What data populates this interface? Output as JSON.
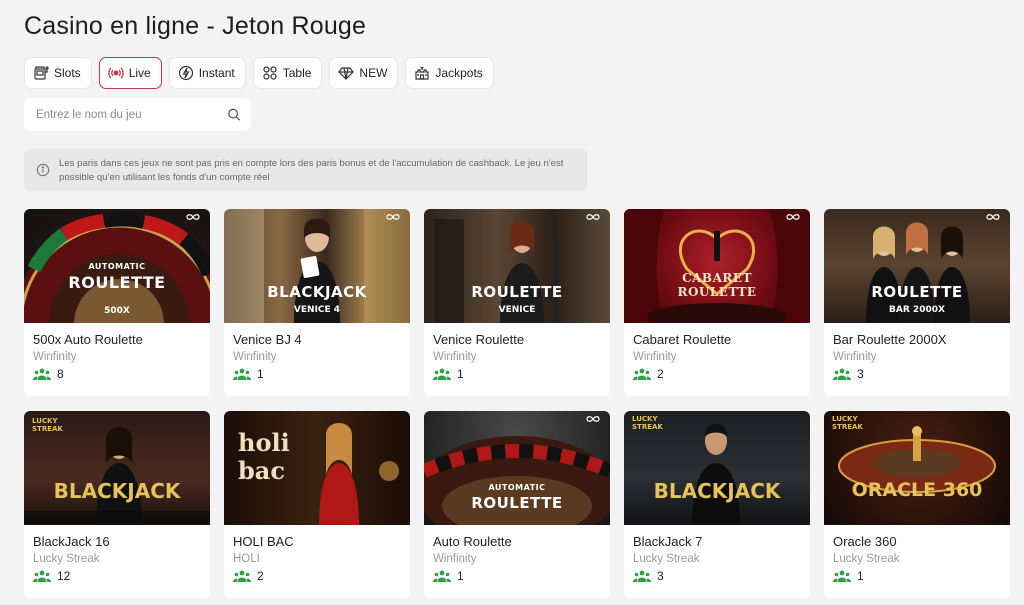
{
  "page": {
    "title": "Casino en ligne - Jeton Rouge"
  },
  "filters": [
    {
      "label": "Slots",
      "icon": "slot-machine-icon",
      "active": false
    },
    {
      "label": "Live",
      "icon": "live-broadcast-icon",
      "active": true
    },
    {
      "label": "Instant",
      "icon": "lightning-icon",
      "active": false
    },
    {
      "label": "Table",
      "icon": "table-games-icon",
      "active": false
    },
    {
      "label": "NEW",
      "icon": "diamond-icon",
      "active": false
    },
    {
      "label": "Jackpots",
      "icon": "castle-icon",
      "active": false
    }
  ],
  "search": {
    "placeholder": "Entrez le nom du jeu"
  },
  "notice": {
    "text": "Les paris dans ces jeux ne sont pas pris en compte lors des paris bonus et de l'accumulation de cashback. Le jeu n'est possible qu'en utilisant les fonds d'un compte réel"
  },
  "colors": {
    "accent": "#c8364a",
    "players_icon": "#2ea043"
  },
  "games": [
    {
      "name": "500x Auto Roulette",
      "provider": "Winfinity",
      "players": "8",
      "thumb": {
        "line1": "AUTOMATIC",
        "line2": "ROULETTE",
        "line3": "500X"
      }
    },
    {
      "name": "Venice BJ 4",
      "provider": "Winfinity",
      "players": "1",
      "thumb": {
        "line1": "",
        "line2": "BLACKJACK",
        "line3": "VENICE 4"
      }
    },
    {
      "name": "Venice Roulette",
      "provider": "Winfinity",
      "players": "1",
      "thumb": {
        "line1": "",
        "line2": "ROULETTE",
        "line3": "VENICE"
      }
    },
    {
      "name": "Cabaret Roulette",
      "provider": "Winfinity",
      "players": "2",
      "thumb": {
        "line1": "CABARET",
        "line2": "ROULETTE",
        "line3": ""
      }
    },
    {
      "name": "Bar Roulette 2000X",
      "provider": "Winfinity",
      "players": "3",
      "thumb": {
        "line1": "",
        "line2": "ROULETTE",
        "line3": "BAR 2000X"
      }
    },
    {
      "name": "BlackJack 16",
      "provider": "Lucky Streak",
      "players": "12",
      "thumb": {
        "line1": "LUCKY STREAK",
        "line2": "BLACKJACK",
        "line3": ""
      }
    },
    {
      "name": "HOLI BAC",
      "provider": "HOLI",
      "players": "2",
      "thumb": {
        "line1": "holi",
        "line2": "bac",
        "line3": ""
      }
    },
    {
      "name": "Auto Roulette",
      "provider": "Winfinity",
      "players": "1",
      "thumb": {
        "line1": "AUTOMATIC",
        "line2": "ROULETTE",
        "line3": ""
      }
    },
    {
      "name": "BlackJack 7",
      "provider": "Lucky Streak",
      "players": "3",
      "thumb": {
        "line1": "LUCKY STREAK",
        "line2": "BLACKJACK",
        "line3": ""
      }
    },
    {
      "name": "Oracle 360",
      "provider": "Lucky Streak",
      "players": "1",
      "thumb": {
        "line1": "LUCKY STREAK",
        "line2": "ORACLE 360",
        "line3": ""
      }
    }
  ]
}
